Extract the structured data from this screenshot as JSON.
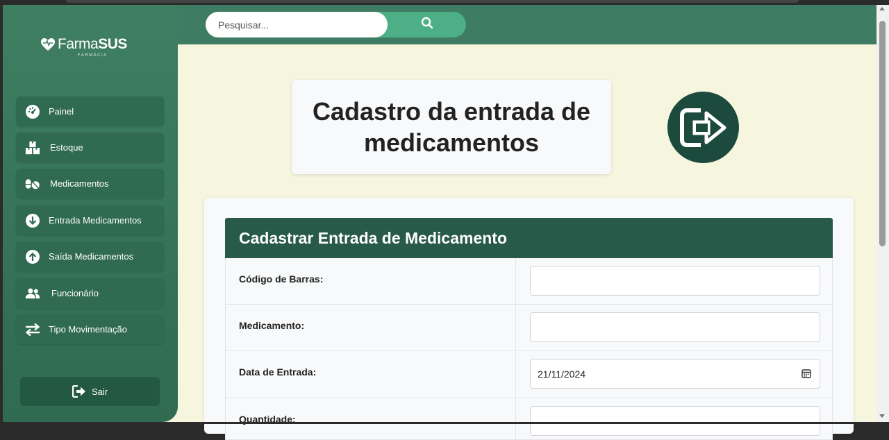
{
  "search": {
    "placeholder": "Pesquisar...",
    "icon": "search-icon"
  },
  "logo": {
    "brand_regular": "Farma",
    "brand_bold": "SUS",
    "subtitle": "FARMÁCIA"
  },
  "sidebar": {
    "items": [
      {
        "label": "Painel",
        "icon": "dashboard-icon"
      },
      {
        "label": "Estoque",
        "icon": "boxes-icon"
      },
      {
        "label": "Medicamentos",
        "icon": "pills-icon"
      },
      {
        "label": "Entrada Medicamentos",
        "icon": "arrow-down-circle-icon"
      },
      {
        "label": "Saída Medicamentos",
        "icon": "arrow-up-circle-icon"
      },
      {
        "label": "Funcionário",
        "icon": "users-icon"
      },
      {
        "label": "Tipo Movimentação",
        "icon": "exchange-icon"
      }
    ],
    "logout_label": "Sair"
  },
  "page": {
    "title_line1": "Cadastro da entrada de",
    "title_line2": "medicamentos"
  },
  "form": {
    "header": "Cadastrar Entrada de Medicamento",
    "fields": [
      {
        "label": "Código de Barras:",
        "value": ""
      },
      {
        "label": "Medicamento:",
        "value": ""
      },
      {
        "label": "Data de Entrada:",
        "value": "21/11/2024"
      },
      {
        "label": "Quantidade:",
        "value": ""
      }
    ]
  },
  "colors": {
    "primary": "#3e7d63",
    "dark": "#275a48",
    "background": "#f6f5de",
    "accent": "#4caf85"
  }
}
